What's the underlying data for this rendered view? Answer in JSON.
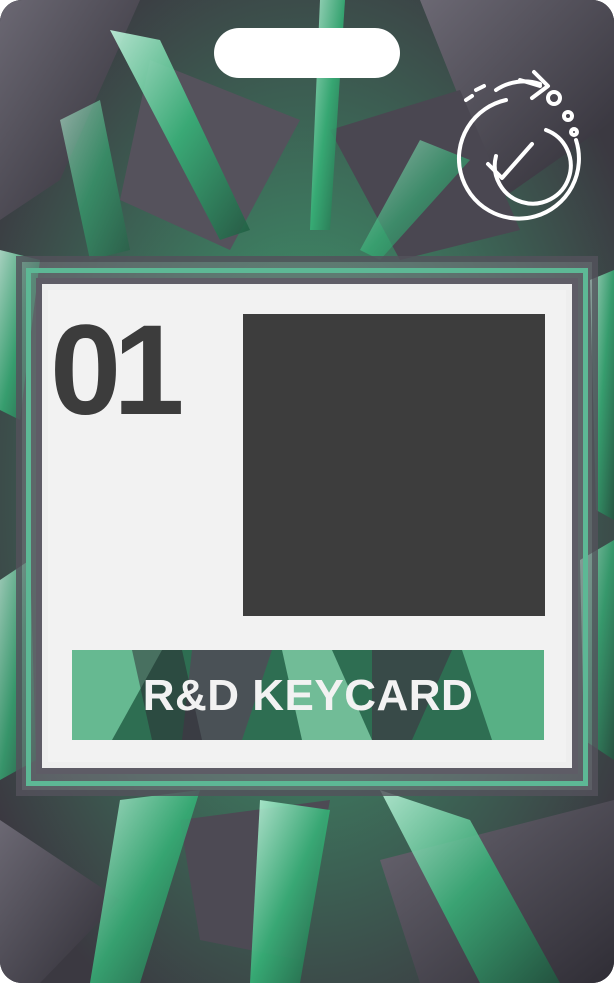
{
  "card": {
    "number": "01",
    "label": "R&D KEYCARD"
  },
  "icons": {
    "badge_icon": "refresh-check-icon"
  },
  "colors": {
    "accent_green": "#5db895",
    "dark": "#3c3c3c",
    "panel": "#f2f2f2"
  }
}
